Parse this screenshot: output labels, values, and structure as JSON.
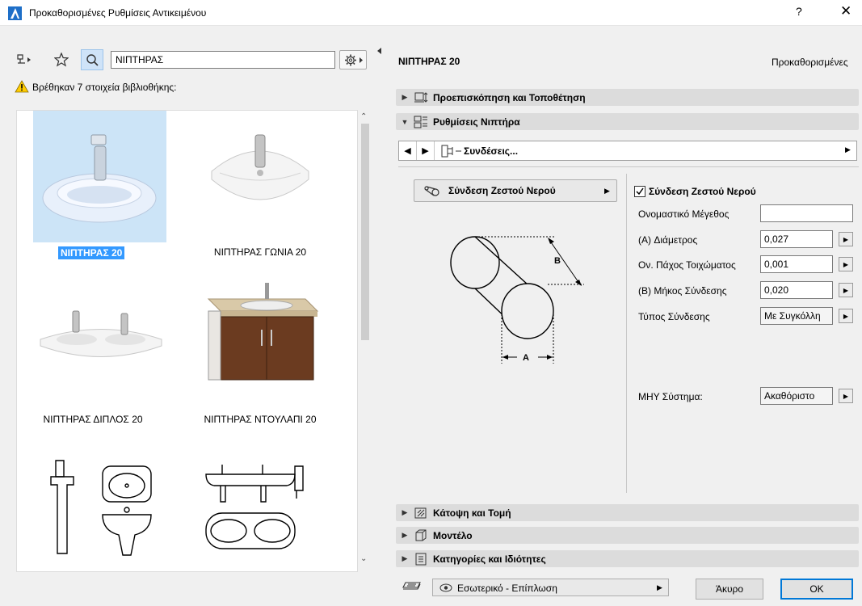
{
  "window": {
    "title": "Προκαθορισμένες Ρυθμίσεις Αντικειμένου",
    "help": "?",
    "close": "✕"
  },
  "library": {
    "search_value": "ΝΙΠΤΗΡΑΣ",
    "found_text": "Βρέθηκαν 7 στοιχεία βιβλιοθήκης:",
    "items": [
      {
        "label": "ΝΙΠΤΗΡΑΣ 20"
      },
      {
        "label": "ΝΙΠΤΗΡΑΣ ΓΩΝΙΑ 20"
      },
      {
        "label": "ΝΙΠΤΗΡΑΣ ΔΙΠΛΟΣ 20"
      },
      {
        "label": "ΝΙΠΤΗΡΑΣ ΝΤΟΥΛΑΠΙ 20"
      }
    ]
  },
  "header": {
    "title": "ΝΙΠΤΗΡΑΣ 20",
    "subtitle": "Προκαθορισμένες"
  },
  "sections": {
    "preview": "Προεπισκόπηση και Τοποθέτηση",
    "settings": "Ρυθμίσεις Νιπτήρα",
    "floorplan": "Κάτοψη και Τομή",
    "model": "Μοντέλο",
    "categories": "Κατηγορίες και Ιδιότητες"
  },
  "nav": {
    "page_label": "Συνδέσεις..."
  },
  "connection": {
    "button_label": "Σύνδεση Ζεστού Νερού",
    "checkbox_label": "Σύνδεση Ζεστού Νερού",
    "checked": true,
    "diagram_label_a": "A",
    "diagram_label_b": "B",
    "props": [
      {
        "label": "Ονομαστικό Μέγεθος",
        "value": ""
      },
      {
        "label": "(A) Διάμετρος",
        "value": "0,027"
      },
      {
        "label": "Ον. Πάχος Τοιχώματος",
        "value": "0,001"
      },
      {
        "label": "(B) Μήκος Σύνδεσης",
        "value": "0,020"
      },
      {
        "label": "Τύπος Σύνδεσης",
        "value": "Με Συγκόλλη"
      }
    ],
    "system_label": "ΜΗΥ Σύστημα:",
    "system_value": "Ακαθόριστο"
  },
  "footer": {
    "view_label": "Εσωτερικό - Επίπλωση",
    "cancel_label": "Άκυρο",
    "ok_label": "OK"
  },
  "colors": {
    "accent": "#0078d7",
    "selection_bg": "#cce4f7",
    "selected_label_bg": "#3399ff"
  }
}
